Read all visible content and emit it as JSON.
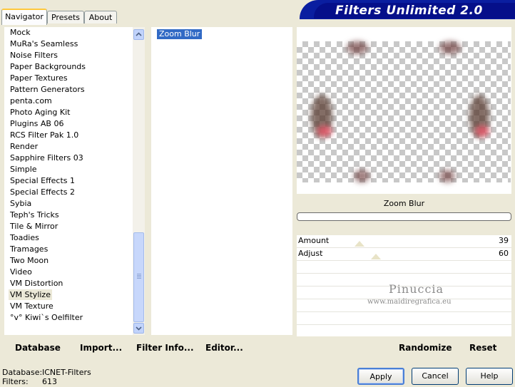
{
  "tabs": [
    {
      "label": "Navigator",
      "active": true
    },
    {
      "label": "Presets",
      "active": false
    },
    {
      "label": "About",
      "active": false
    }
  ],
  "app_title": "Filters Unlimited 2.0",
  "categories": [
    "Mock",
    "MuRa's Seamless",
    "Noise Filters",
    "Paper Backgrounds",
    "Paper Textures",
    "Pattern Generators",
    "penta.com",
    "Photo Aging Kit",
    "Plugins AB 06",
    "RCS Filter Pak 1.0",
    "Render",
    "Sapphire Filters 03",
    "Simple",
    "Special Effects 1",
    "Special Effects 2",
    "Sybia",
    "Teph's Tricks",
    "Tile & Mirror",
    "Toadies",
    "Tramages",
    "Two Moon",
    "Video",
    "VM Distortion",
    "VM Stylize",
    "VM Texture",
    "°v° Kiwi`s Oelfilter"
  ],
  "selected_category": "VM Stylize",
  "filters": [
    "Zoom Blur"
  ],
  "selected_filter": "Zoom Blur",
  "preview": {
    "filter_name": "Zoom Blur"
  },
  "params": [
    {
      "label": "Amount",
      "value": "39",
      "level": 39
    },
    {
      "label": "Adjust",
      "value": "60",
      "level": 60
    }
  ],
  "watermark": {
    "name": "Pinuccia",
    "url": "www.maidiregrafica.eu"
  },
  "bottom_links": {
    "database": "Database",
    "import": "Import...",
    "filter_info": "Filter Info...",
    "editor": "Editor...",
    "randomize": "Randomize",
    "reset": "Reset"
  },
  "status": {
    "database_label": "Database:",
    "database_value": "ICNET-Filters",
    "filters_label": "Filters:",
    "filters_value": "613"
  },
  "buttons": {
    "apply": "Apply",
    "cancel": "Cancel",
    "help": "Help"
  },
  "colors": {
    "selection": "#316ac5",
    "banner": "#0a1ea0",
    "face": "#ece9d8"
  }
}
